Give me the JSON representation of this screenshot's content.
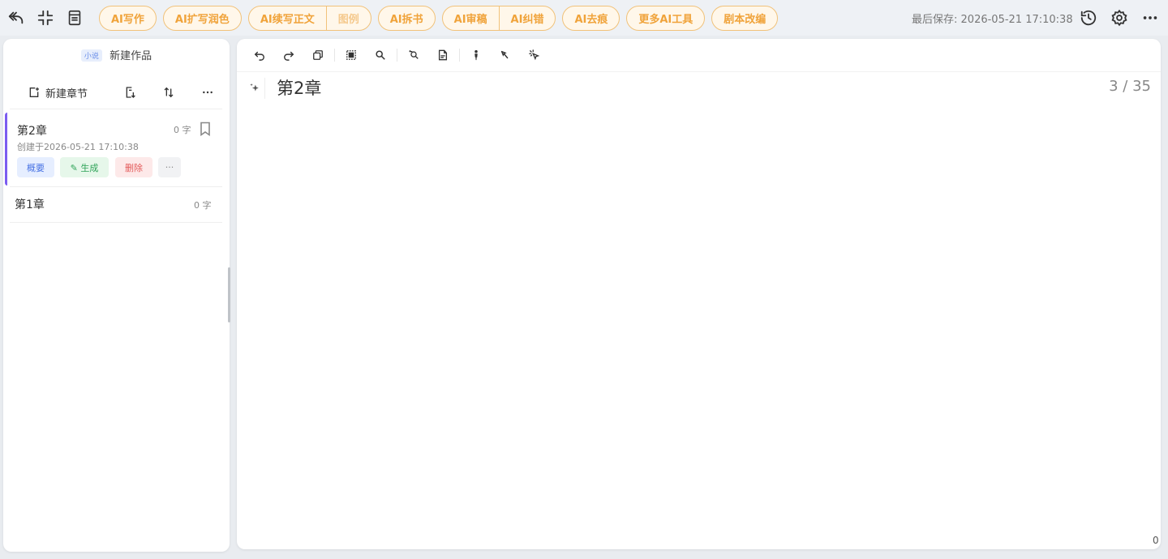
{
  "topbar": {
    "ai_tools": [
      {
        "label": "AI写作"
      },
      {
        "label": "AI扩写润色"
      }
    ],
    "ai_group_1": [
      {
        "label": "AI续写正文"
      },
      {
        "label": "图例"
      }
    ],
    "ai_tool_book": "AI拆书",
    "ai_group_2": [
      {
        "label": "AI审稿"
      },
      {
        "label": "AI纠错"
      }
    ],
    "ai_tool_remove": "AI去痕",
    "ai_tool_more": "更多AI工具",
    "ai_tool_script": "剧本改编",
    "save_label": "最后保存:",
    "save_time": "2026-05-21 17:10:38"
  },
  "sidebar": {
    "tag": "小说",
    "work_title": "新建作品",
    "new_chapter_label": "新建章节",
    "chapters": [
      {
        "title": "第2章",
        "word_count": "0 字",
        "created": "创建于2026-05-21 17:10:38",
        "chips": {
          "summary": "概要",
          "generate": "✎ 生成",
          "delete": "删除",
          "more": "···"
        }
      },
      {
        "title": "第1章",
        "word_count": "0 字"
      }
    ]
  },
  "editor": {
    "chapter_title": "第2章",
    "page_counter": "3 / 35",
    "corner_count": "0"
  },
  "colors": {
    "accent_orange": "#f0a33a",
    "active_chapter": "#7b5cf0"
  }
}
